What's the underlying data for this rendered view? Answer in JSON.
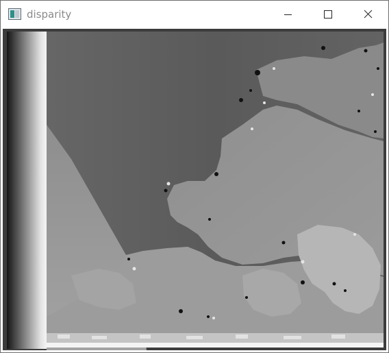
{
  "window": {
    "title": "disparity",
    "app_icon": "app-window-icon"
  },
  "controls": {
    "minimize_icon": "minimize-icon",
    "maximize_icon": "maximize-icon",
    "close_icon": "close-icon"
  },
  "image": {
    "name": "disparity-map",
    "colors": {
      "background_dark": "#3b3b3b",
      "sky_gray": "#5f5f5f",
      "mid_gray": "#8a8a8a",
      "light_gray": "#b3b3b3"
    }
  }
}
